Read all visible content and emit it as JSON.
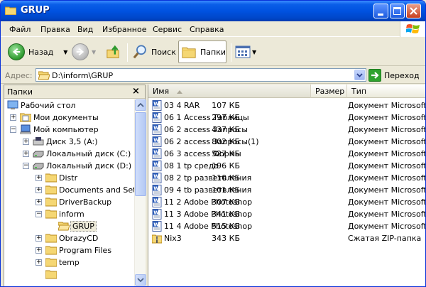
{
  "window": {
    "title": "GRUP"
  },
  "menu": [
    "Файл",
    "Правка",
    "Вид",
    "Избранное",
    "Сервис",
    "Справка"
  ],
  "toolbar": {
    "back_label": "Назад",
    "search_label": "Поиск",
    "folders_label": "Папки"
  },
  "address": {
    "label": "Адрес:",
    "value": "D:\\inform\\GRUP",
    "go_label": "Переход"
  },
  "folders": {
    "title": "Папки",
    "close_glyph": "×",
    "tree": [
      {
        "label": "Рабочий стол",
        "icon": "desktop-icon"
      },
      {
        "label": "Мои документы",
        "icon": "my-documents-icon",
        "toggle": "+"
      },
      {
        "label": "Мой компьютер",
        "icon": "my-computer-icon",
        "toggle": "−"
      },
      {
        "label": "Диск 3,5 (A:)",
        "icon": "floppy-drive-icon",
        "toggle": "+"
      },
      {
        "label": "Локальный диск (C:)",
        "icon": "hard-drive-icon",
        "toggle": "+"
      },
      {
        "label": "Локальный диск (D:)",
        "icon": "hard-drive-icon",
        "toggle": "−"
      },
      {
        "label": "Distr",
        "icon": "folder-icon",
        "toggle": "+"
      },
      {
        "label": "Documents and Settings",
        "icon": "folder-icon",
        "toggle": "+"
      },
      {
        "label": "DriverBackup",
        "icon": "folder-icon",
        "toggle": "+"
      },
      {
        "label": "inform",
        "icon": "folder-icon",
        "toggle": "−"
      },
      {
        "label": "GRUP",
        "icon": "open-folder-icon"
      },
      {
        "label": "ObrazyCD",
        "icon": "folder-icon",
        "toggle": "+"
      },
      {
        "label": "Program Files",
        "icon": "folder-icon",
        "toggle": "+"
      },
      {
        "label": "temp",
        "icon": "folder-icon",
        "toggle": "+"
      }
    ]
  },
  "columns": {
    "name": "Имя",
    "size": "Размер",
    "type": "Тип"
  },
  "files": [
    {
      "name": "03 4 RAR",
      "size": "107 КБ",
      "type": "Документ Microsoft Word",
      "icon": "word-doc-icon"
    },
    {
      "name": "06 1  Access Таблицы",
      "size": "297 КБ",
      "type": "Документ Microsoft Word",
      "icon": "word-doc-icon"
    },
    {
      "name": "06 2 access Запросы",
      "size": "437 КБ",
      "type": "Документ Microsoft Word",
      "icon": "word-doc-icon"
    },
    {
      "name": "06 2 access Запросы(1)",
      "size": "802 КБ",
      "type": "Документ Microsoft Word",
      "icon": "word-doc-icon"
    },
    {
      "name": "06 3 access Формы",
      "size": "527 КБ",
      "type": "Документ Microsoft Word",
      "icon": "word-doc-icon"
    },
    {
      "name": "08 1 tp среда",
      "size": "196 КБ",
      "type": "Документ Microsoft Word",
      "icon": "word-doc-icon"
    },
    {
      "name": "08 2 tp разветвления",
      "size": "110 КБ",
      "type": "Документ Microsoft Word",
      "icon": "word-doc-icon"
    },
    {
      "name": "09 4 tb разветвления",
      "size": "101 КБ",
      "type": "Документ Microsoft Word",
      "icon": "word-doc-icon"
    },
    {
      "name": "11 2 Adobe Photoshop",
      "size": "307 КБ",
      "type": "Документ Microsoft Word",
      "icon": "word-doc-icon"
    },
    {
      "name": "11 3 Adobe Photoshop",
      "size": "341 КБ",
      "type": "Документ Microsoft Word",
      "icon": "word-doc-icon"
    },
    {
      "name": "11 4 Adobe Photoshop",
      "size": "515 КБ",
      "type": "Документ Microsoft Word",
      "icon": "word-doc-icon"
    },
    {
      "name": "Nix3",
      "size": "343 КБ",
      "type": "Сжатая ZIP-папка",
      "icon": "zip-folder-icon"
    }
  ]
}
